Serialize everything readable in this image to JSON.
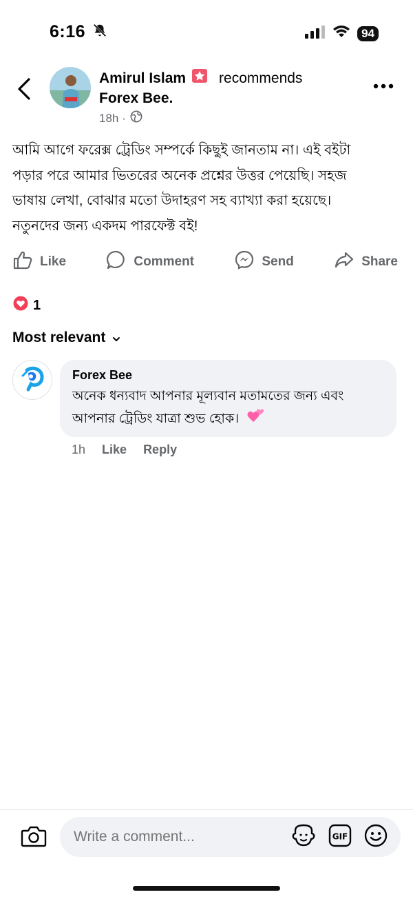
{
  "status_bar": {
    "time": "6:16",
    "battery": "94"
  },
  "post": {
    "author": "Amirul Islam",
    "action_text": "recommends",
    "page_name": "Forex Bee.",
    "time_ago": "18h ·",
    "text_lines": [
      "আমি আগে ফরেক্স ট্রেডিং সম্পর্কে কিছুই জানতাম না। এই বইটা",
      "পড়ার পরে আমার ভিতরের অনেক প্রশ্নের উত্তর পেয়েছি। সহজ",
      "ভাষায় লেখা, বোঝার মতো উদাহরণ সহ ব্যাখ্যা করা হয়েছে।",
      "নতুনদের জন্য একদম পারফেক্ট বই!"
    ]
  },
  "actions": {
    "like": "Like",
    "comment": "Comment",
    "send": "Send",
    "share": "Share"
  },
  "reactions": {
    "count": "1"
  },
  "comments_sort": {
    "label": "Most relevant"
  },
  "comment": {
    "author": "Forex Bee",
    "text_lines": [
      "অনেক ধন্যবাদ আপনার মূল্যবান মতামতের জন্য এবং",
      "আপনার ট্রেডিং  যাত্রা শুভ হোক।"
    ],
    "time_ago": "1h",
    "like": "Like",
    "reply": "Reply"
  },
  "composer": {
    "placeholder": "Write a comment..."
  },
  "colors": {
    "accent": "#1877f2",
    "text_secondary": "#65676b",
    "bubble": "#f0f2f5",
    "love": "#f33e58"
  }
}
